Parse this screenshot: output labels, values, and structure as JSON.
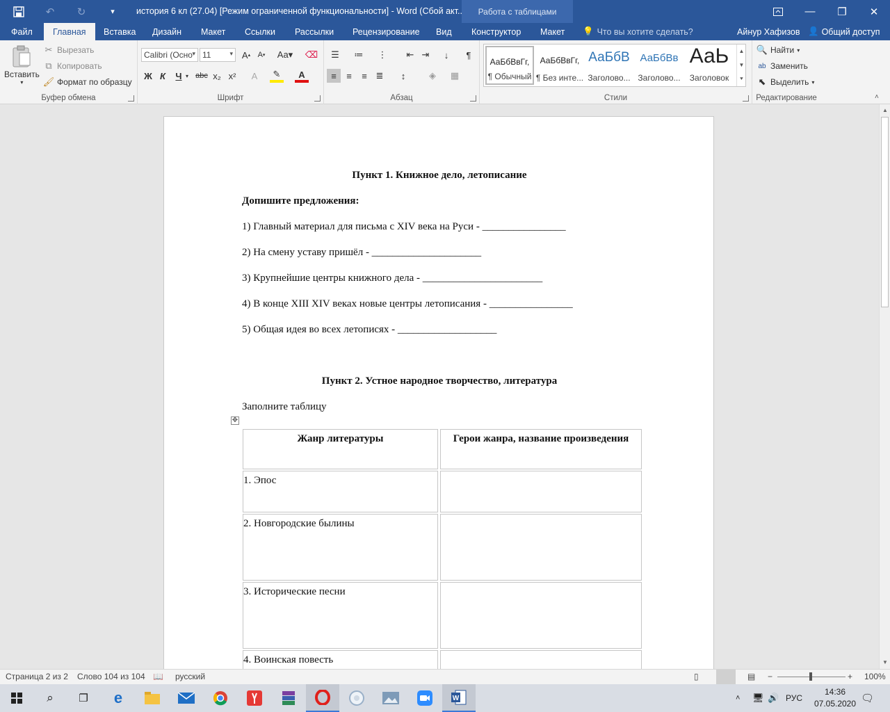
{
  "titlebar": {
    "title": "история 6 кл (27.04) [Режим ограниченной функциональности] - Word (Сбой акт...",
    "context_tab": "Работа с таблицами"
  },
  "tabs": {
    "file": "Файл",
    "home": "Главная",
    "insert": "Вставка",
    "design": "Дизайн",
    "layout": "Макет",
    "references": "Ссылки",
    "mailings": "Рассылки",
    "review": "Рецензирование",
    "view": "Вид",
    "constructor": "Конструктор",
    "table_layout": "Макет",
    "tellme": "Что вы хотите сделать?",
    "user": "Айнур Хафизов",
    "share": "Общий доступ"
  },
  "ribbon": {
    "clipboard": {
      "paste": "Вставить",
      "cut": "Вырезать",
      "copy": "Копировать",
      "format_painter": "Формат по образцу",
      "label": "Буфер обмена"
    },
    "font": {
      "font_name": "Calibri (Осно",
      "font_size": "11",
      "bold": "Ж",
      "italic": "К",
      "underline": "Ч",
      "strike": "abc",
      "sub": "x₂",
      "sup": "x²",
      "label": "Шрифт"
    },
    "paragraph": {
      "label": "Абзац"
    },
    "styles": {
      "label": "Стили",
      "items": [
        {
          "preview": "АаБбВвГг,",
          "name": "¶ Обычный"
        },
        {
          "preview": "АаБбВвГг,",
          "name": "¶ Без инте..."
        },
        {
          "preview": "АаБбВ",
          "name": "Заголово..."
        },
        {
          "preview": "АаБбВв",
          "name": "Заголово..."
        },
        {
          "preview": "АаЬ",
          "name": "Заголовок"
        }
      ]
    },
    "editing": {
      "find": "Найти",
      "replace": "Заменить",
      "select": "Выделить",
      "label": "Редактирование"
    }
  },
  "document": {
    "heading1": "Пункт 1. Книжное дело, летописание",
    "instruction": "Допишите предложения:",
    "items": [
      "1) Главный материал для письма с XIV века на Руси - ________________",
      "2) На смену уставу пришёл - _____________________",
      "3) Крупнейшие центры книжного дела - _______________________",
      "4) В конце XIII XIV веках новые центры летописания - ________________",
      "5) Общая идея во всех летописях - ___________________"
    ],
    "heading2": "Пункт 2. Устное народное творчество, литература",
    "table_instruction": "Заполните таблицу",
    "table": {
      "headers": [
        "Жанр литературы",
        "Герои жанра, название произведения"
      ],
      "rows": [
        "1. Эпос",
        "2. Новгородские былины",
        "3. Исторические песни",
        "4. Воинская повесть"
      ]
    }
  },
  "statusbar": {
    "page": "Страница 2 из 2",
    "words": "Слово 104 из 104",
    "language": "русский",
    "zoom": "100%"
  },
  "taskbar": {
    "language": "РУС",
    "time": "14:36",
    "date": "07.05.2020"
  }
}
